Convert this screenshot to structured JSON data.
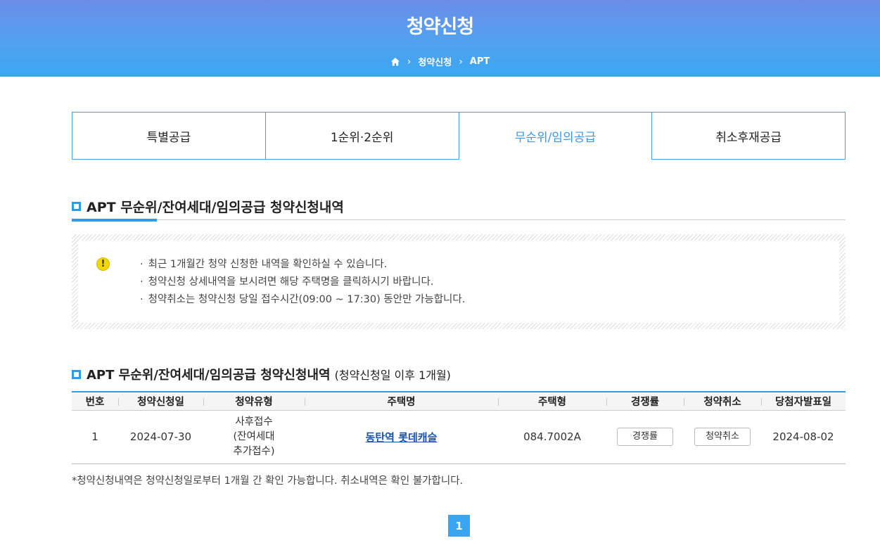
{
  "header": {
    "title": "청약신청",
    "breadcrumb": {
      "home_icon": "home-icon",
      "level1": "청약신청",
      "level2": "APT"
    }
  },
  "tabs": [
    {
      "label": "특별공급",
      "active": false
    },
    {
      "label": "1순위·2순위",
      "active": false
    },
    {
      "label": "무순위/임의공급",
      "active": true
    },
    {
      "label": "취소후재공급",
      "active": false
    }
  ],
  "section1": {
    "title": "APT 무순위/잔여세대/임의공급 청약신청내역"
  },
  "notice": {
    "icon": "warning-icon",
    "items": [
      "최근 1개월간 청약 신청한 내역을 확인하실 수 있습니다.",
      "청약신청 상세내역을 보시려면 해당 주택명을 클릭하시기 바랍니다.",
      "청약취소는 청약신청 당일 접수시간(09:00 ~ 17:30) 동안만 가능합니다."
    ]
  },
  "section2": {
    "title": "APT 무순위/잔여세대/임의공급 청약신청내역",
    "subtitle": "(청약신청일 이후 1개월)"
  },
  "table": {
    "headers": [
      "번호",
      "청약신청일",
      "청약유형",
      "주택명",
      "주택형",
      "경쟁률",
      "청약취소",
      "당첨자발표일"
    ],
    "rows": [
      {
        "no": "1",
        "date": "2024-07-30",
        "type_line1": "사후접수",
        "type_line2": "(잔여세대",
        "type_line3": "추가접수)",
        "house_name": "동탄역 롯데캐슬",
        "house_type": "084.7002A",
        "rate_button": "경쟁률",
        "cancel_button": "청약취소",
        "announce_date": "2024-08-02"
      }
    ]
  },
  "footnote": "*청약신청내역은 청약신청일로부터 1개월 간 확인 가능합니다. 취소내역은 확인 불가합니다.",
  "pagination": {
    "current": "1"
  }
}
